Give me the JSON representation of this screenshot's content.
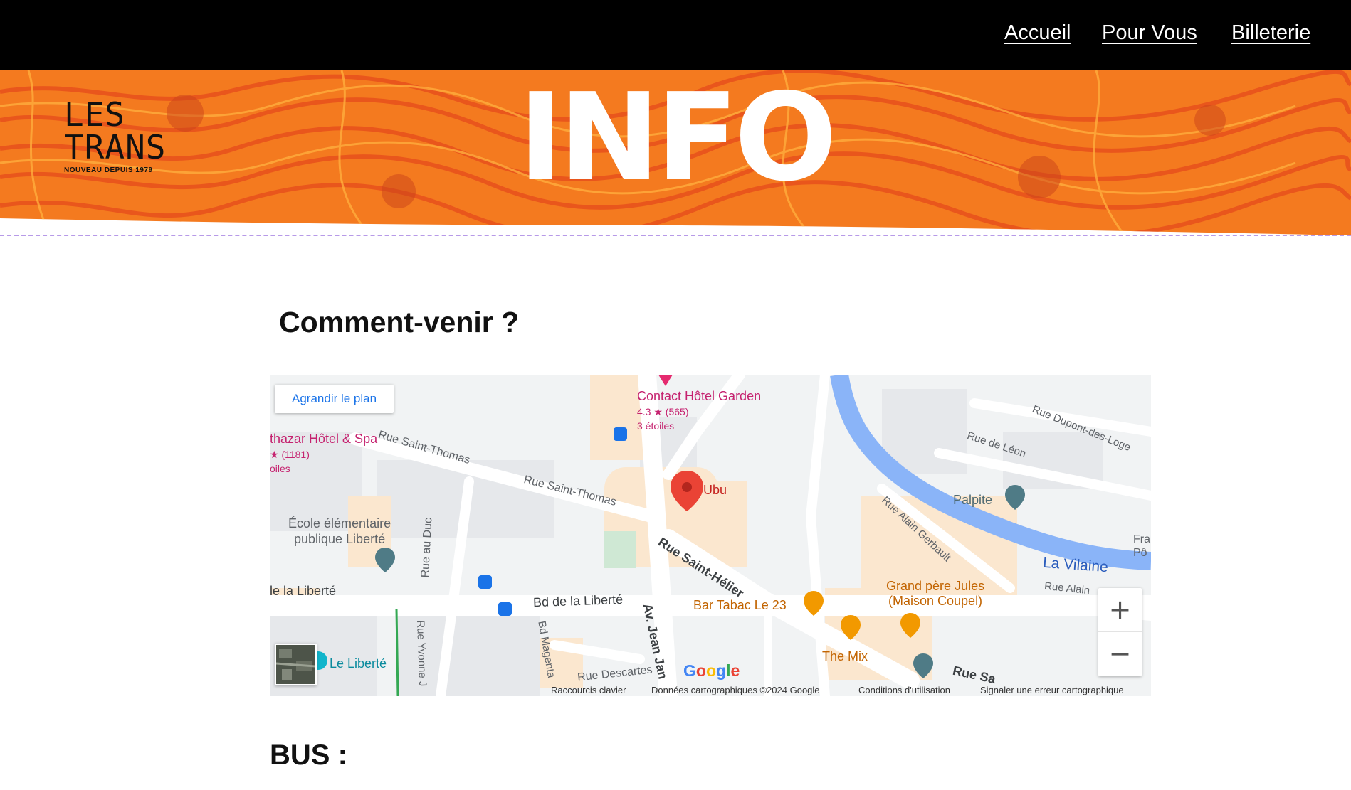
{
  "nav": {
    "accueil": "Accueil",
    "pour_vous": "Pour Vous",
    "billeterie": "Billeterie"
  },
  "logo": {
    "line1": "LES",
    "line2": "TRANS",
    "tagline": "NOUVEAU DEPUIS 1979"
  },
  "banner": {
    "title": "INFO"
  },
  "section": {
    "heading": "Comment-venir ?"
  },
  "map": {
    "enlarge_label": "Agrandir le plan",
    "places": {
      "hotel_garden": {
        "name": "Contact Hôtel Garden",
        "rating": "4.3 ★ (565)",
        "stars": "3 étoiles"
      },
      "balthazar": {
        "name": "thazar Hôtel & Spa",
        "rating": "★ (1181)",
        "stars": "oiles"
      },
      "ecole": "École élémentaire\npublique Liberté",
      "ubu": "Ubu",
      "palpite": "Palpite",
      "bar_tabac": "Bar Tabac Le 23",
      "grand_pere": "Grand père Jules\n(Maison Coupel)",
      "the_mix": "The Mix",
      "le_liberte": "Le Liberté",
      "vilaine": "La Vilaine",
      "fra": "Fra\nPô"
    },
    "streets": {
      "saint_thomas_1": "Rue Saint-Thomas",
      "saint_thomas_2": "Rue Saint-Thomas",
      "saint_helier": "Rue Saint-Hélier",
      "du_duc": "Rue au Duc",
      "bd_liberte_left": "le la Liberté",
      "bd_liberte": "Bd de la Liberté",
      "jean_janvier": "Av. Jean Jan",
      "bd_magenta": "Bd Magenta",
      "yvonne": "Rue Yvonne J",
      "descartes": "Rue Descartes",
      "dupont": "Rue Dupont-des-Loge",
      "de_leon": "Rue de Léon",
      "alain_gerbault": "Rue Alain Gerbault",
      "rue_alain": "Rue Alain",
      "rue_sa": "Rue Sa"
    },
    "zoom_in": "+",
    "zoom_out": "−",
    "google": "Google",
    "attribution": {
      "shortcuts": "Raccourcis clavier",
      "data": "Données cartographiques ©2024 Google",
      "terms": "Conditions d'utilisation",
      "report": "Signaler une erreur cartographique"
    }
  },
  "bus": {
    "heading": "BUS :"
  },
  "colors": {
    "nav_bg": "#000000",
    "banner_orange": "#f47a1f",
    "banner_red": "#e8531c",
    "divider": "#b79ae8",
    "map_water": "#8ab4f8",
    "map_pin": "#ea4335",
    "map_link": "#1a73e8"
  }
}
